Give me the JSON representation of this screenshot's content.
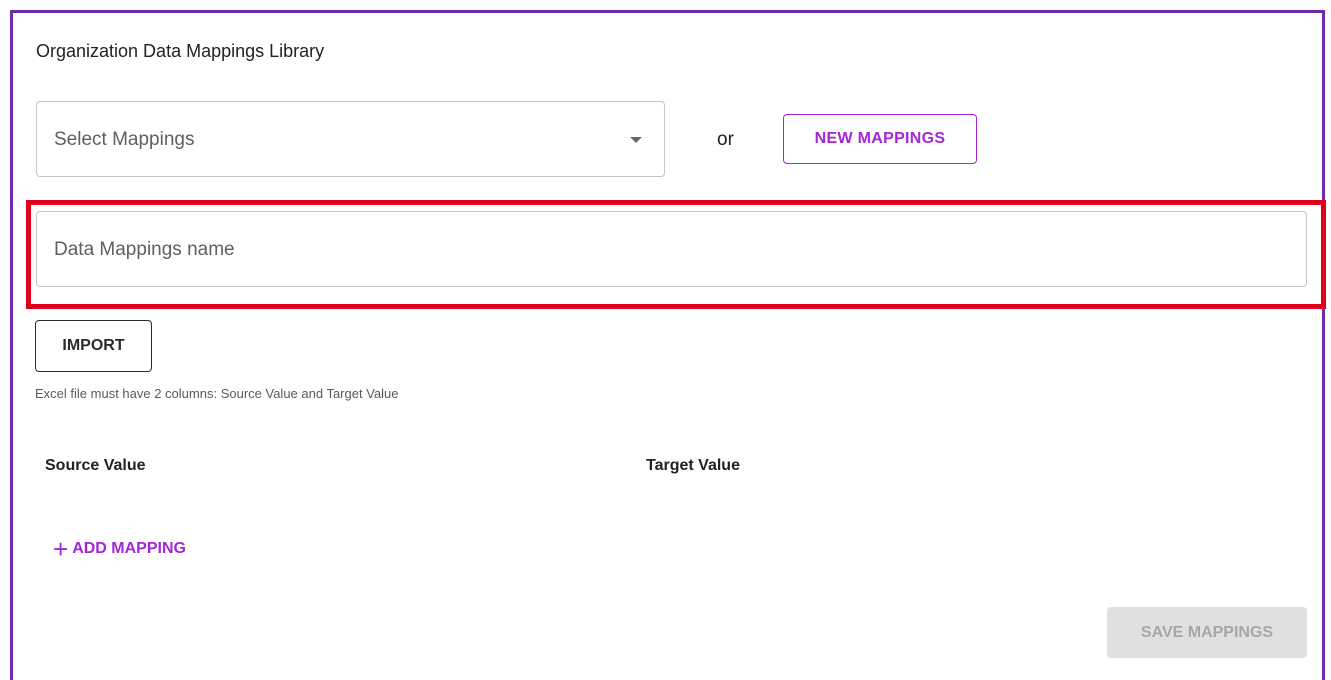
{
  "library": {
    "title": "Organization Data Mappings Library"
  },
  "select": {
    "placeholder": "Select Mappings",
    "icon": "caret-down-icon"
  },
  "or_label": "or",
  "buttons": {
    "new_mappings": "NEW MAPPINGS",
    "import": "IMPORT",
    "add_mapping": "ADD MAPPING",
    "save_mappings": "SAVE MAPPINGS"
  },
  "name_input": {
    "placeholder": "Data Mappings name",
    "value": ""
  },
  "hint": "Excel file must have 2 columns: Source Value and Target Value",
  "table": {
    "columns": [
      "Source Value",
      "Target Value"
    ]
  },
  "icons": {
    "add": "+"
  },
  "colors": {
    "accent": "#a426d6",
    "frame": "#6f2bb0",
    "highlight": "#e0001b",
    "disabled_bg": "#e0e0e0",
    "disabled_text": "#a7a7a7"
  }
}
